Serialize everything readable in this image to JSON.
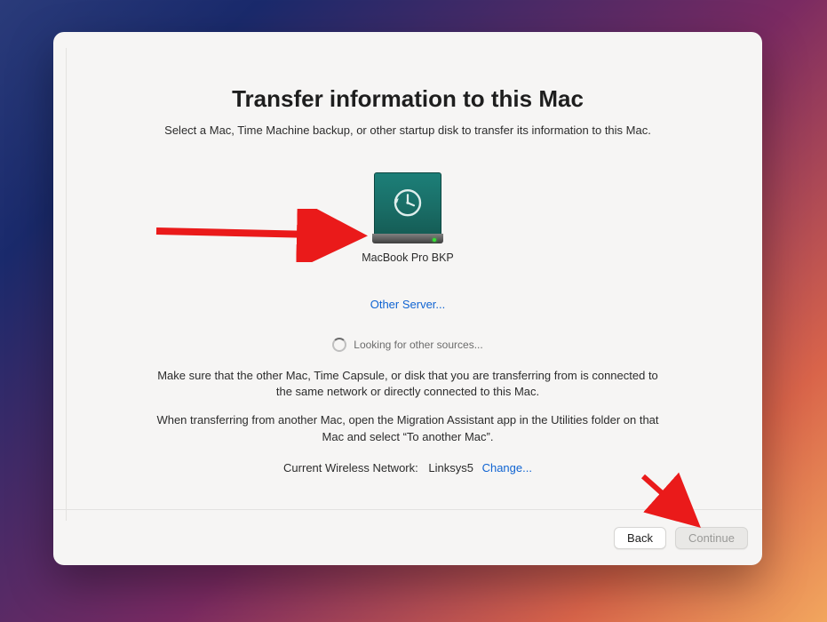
{
  "header": {
    "title": "Transfer information to this Mac",
    "subtitle": "Select a Mac, Time Machine backup, or other startup disk to transfer its information to this Mac."
  },
  "source": {
    "icon": "time-machine-disk-icon",
    "label": "MacBook Pro BKP"
  },
  "links": {
    "other_server": "Other Server...",
    "change": "Change..."
  },
  "status": {
    "looking": "Looking for other sources..."
  },
  "helper": {
    "line1": "Make sure that the other Mac, Time Capsule, or disk that you are transferring from is connected to the same network or directly connected to this Mac.",
    "line2": "When transferring from another Mac, open the Migration Assistant app in the Utilities folder on that Mac and select “To another Mac”."
  },
  "network": {
    "label": "Current Wireless Network:",
    "name": "Linksys5"
  },
  "footer": {
    "back": "Back",
    "continue": "Continue"
  }
}
